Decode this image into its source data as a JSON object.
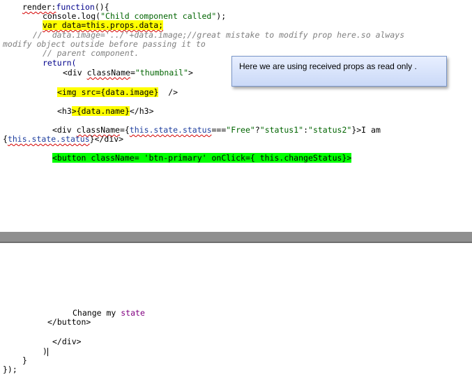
{
  "code_top": {
    "l1_a": "render:",
    "l1_b": "function",
    "l1_c": "(){",
    "l2_a": "console.log(",
    "l2_b": "\"Child component called\"",
    "l2_c": ");",
    "l3": "var data=this.props.data;",
    "l4_a": "//  data.image='../'+data.image;//great mistake to modify prop here.so always",
    "l4_b": "modify object outside before passing it to",
    "l4_c": "// parent component.",
    "l5": "return(",
    "l6_a": "<div ",
    "l6_b": "className",
    "l6_c": "=",
    "l6_d": "\"thumbnail\"",
    "l6_e": ">",
    "l7_hl": "<img src={data.image}",
    "l7_rest": "  />",
    "l8_a": "<h3",
    "l8_hl": ">{data.name}",
    "l8_c": "</h3>",
    "l9_a": "<div ",
    "l9_b": "className",
    "l9_c": "={",
    "l9_d": "this.state.status",
    "l9_e": "===",
    "l9_f": "\"Free\"",
    "l9_g": "?",
    "l9_h": "\"status1\"",
    "l9_i": ":",
    "l9_j": "\"status2\"",
    "l9_k": "}>I am",
    "l10_a": "{",
    "l10_b": "this.state.status",
    "l10_c": "}</div>",
    "l11": "<button className= 'btn-primary' onClick={ this.changeStatus}>"
  },
  "callout": {
    "text": "Here we are using received props as read only ."
  },
  "code_bottom": {
    "l1_a": "Change my ",
    "l1_b": "state",
    "l2": "</button>",
    "l3": "</div>",
    "l4": ")",
    "l5": "}",
    "l6": "});"
  }
}
